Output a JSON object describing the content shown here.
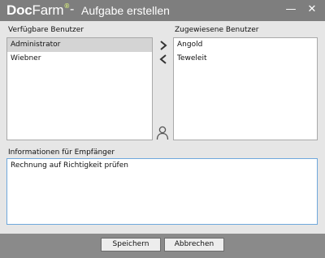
{
  "window": {
    "brand_bold": "Doc",
    "brand_light": "Farm",
    "brand_reg": "®",
    "separator": "-",
    "title": "Aufgabe erstellen",
    "minimize_glyph": "—",
    "close_glyph": "✕"
  },
  "available": {
    "label": "Verfügbare Benutzer",
    "items": [
      {
        "label": "Administrator",
        "selected": true
      },
      {
        "label": "Wiebner",
        "selected": false
      }
    ]
  },
  "assigned": {
    "label": "Zugewiesene Benutzer",
    "items": [
      {
        "label": "Angold"
      },
      {
        "label": "Teweleit"
      }
    ]
  },
  "transfer": {
    "add_icon": "chevron-right-icon",
    "remove_icon": "chevron-left-icon",
    "user_icon": "person-icon"
  },
  "info": {
    "label": "Informationen für Empfänger",
    "value": "Rechnung auf Richtigkeit prüfen"
  },
  "buttons": {
    "save": "Speichern",
    "cancel": "Abbrechen"
  },
  "colors": {
    "titlebar": "#7e7e7e",
    "panel": "#e6e6e6",
    "selection": "#d4d4d4",
    "focus_border": "#6fa8dc",
    "brand_accent": "#d8f07a"
  }
}
